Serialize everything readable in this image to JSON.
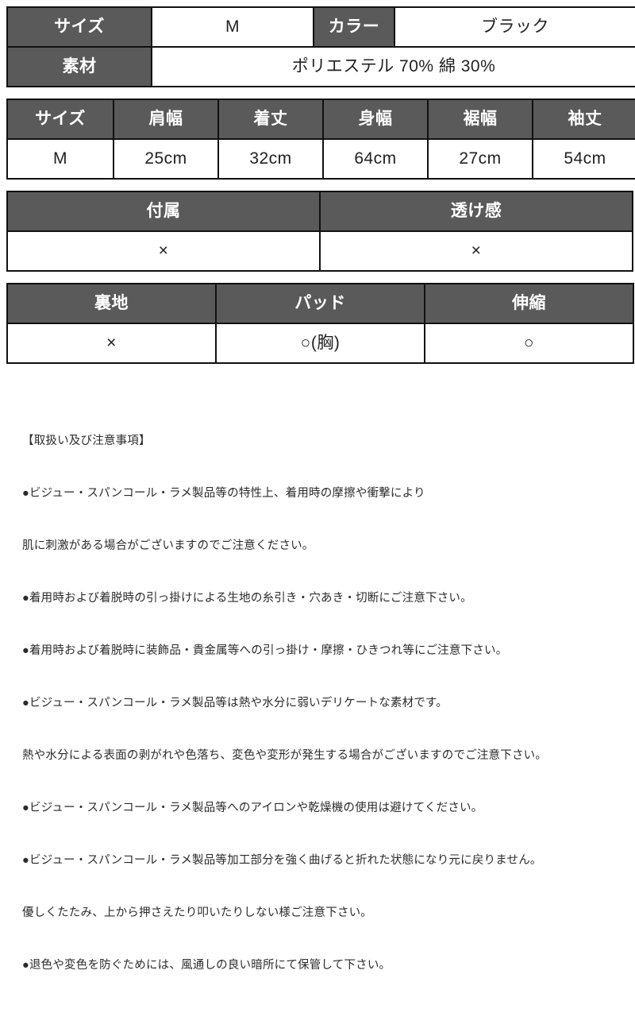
{
  "product_spec": {
    "basic_table": {
      "rows": [
        {
          "label_1": "サイズ",
          "value_1": "M",
          "label_2": "カラー",
          "value_2": "ブラック"
        },
        {
          "label_1": "素材",
          "value_1": "ポリエステル 70%  綿 30%"
        }
      ]
    },
    "measurement_table": {
      "headers": [
        "サイズ",
        "肩幅",
        "着丈",
        "身幅",
        "裾幅",
        "袖丈"
      ],
      "rows": [
        [
          "M",
          "25cm",
          "32cm",
          "64cm",
          "27cm",
          "54cm"
        ]
      ]
    },
    "attribute_table": {
      "group_1": {
        "headers": [
          "付属",
          "透け感"
        ],
        "values": [
          "×",
          "×"
        ]
      },
      "group_2": {
        "headers": [
          "裏地",
          "パッド",
          "伸縮"
        ],
        "values": [
          "×",
          "○(胸)",
          "○"
        ]
      }
    },
    "notes": {
      "title": "【取扱い及び注意事項】",
      "lines": [
        "●ビジュー・スパンコール・ラメ製品等の特性上、着用時の摩擦や衝撃により",
        "肌に刺激がある場合がございますのでご注意ください。",
        "●着用時および着脱時の引っ掛けによる生地の糸引き・穴あき・切断にご注意下さい。",
        "●着用時および着脱時に装飾品・貴金属等への引っ掛け・摩擦・ひきつれ等にご注意下さい。",
        "●ビジュー・スパンコール・ラメ製品等は熱や水分に弱いデリケートな素材です。",
        "熱や水分による表面の剥がれや色落ち、変色や変形が発生する場合がございますのでご注意下さい。",
        "●ビジュー・スパンコール・ラメ製品等へのアイロンや乾燥機の使用は避けてください。",
        "●ビジュー・スパンコール・ラメ製品等加工部分を強く曲げると折れた状態になり元に戻りません。",
        "優しくたたみ、上から押さえたり叩いたりしない様ご注意下さい。",
        "●退色や変色を防ぐためには、風通しの良い暗所にて保管して下さい。"
      ]
    },
    "colors": {
      "header_bg": "#5a5a5a",
      "header_text": "#ffffff",
      "cell_bg": "#ffffff",
      "border": "#111111",
      "body_text": "#2b2b2b"
    }
  }
}
